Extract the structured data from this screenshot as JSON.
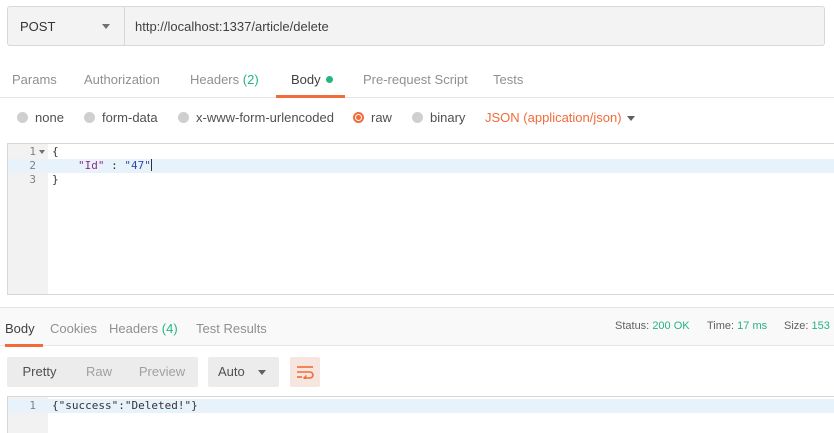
{
  "request": {
    "method": "POST",
    "url": "http://localhost:1337/article/delete"
  },
  "request_tabs": {
    "params": "Params",
    "authorization": "Authorization",
    "headers": "Headers",
    "headers_count": "(2)",
    "body": "Body",
    "prerequest": "Pre-request Script",
    "tests": "Tests"
  },
  "body_types": {
    "none": "none",
    "form_data": "form-data",
    "urlencoded": "x-www-form-urlencoded",
    "raw": "raw",
    "binary": "binary",
    "selected": "raw",
    "content_type": "JSON (application/json)"
  },
  "request_body": {
    "lines": [
      {
        "num": "1",
        "text": "{"
      },
      {
        "num": "2",
        "key": "\"Id\"",
        "sep": " : ",
        "value": "\"47\""
      },
      {
        "num": "3",
        "text": "}"
      }
    ]
  },
  "response_tabs": {
    "body": "Body",
    "cookies": "Cookies",
    "headers": "Headers",
    "headers_count": "(4)",
    "test_results": "Test Results"
  },
  "response_stats": {
    "status_label": "Status:",
    "status_value": "200 OK",
    "time_label": "Time:",
    "time_value": "17 ms",
    "size_label": "Size:",
    "size_value": "153"
  },
  "response_view": {
    "pretty": "Pretty",
    "raw": "Raw",
    "preview": "Preview",
    "format": "Auto"
  },
  "response_body": {
    "lines": [
      {
        "num": "1",
        "text": "{\"success\":\"Deleted!\"}"
      }
    ]
  },
  "colors": {
    "accent": "#f26b3a",
    "success": "#26b47f"
  },
  "icons": {
    "method_dropdown": "chevron-down-icon",
    "body_active": "dot-icon",
    "content_type_dropdown": "chevron-down-icon",
    "format_dropdown": "chevron-down-icon",
    "wrap": "wrap-lines-icon",
    "fold": "fold-caret-icon"
  }
}
